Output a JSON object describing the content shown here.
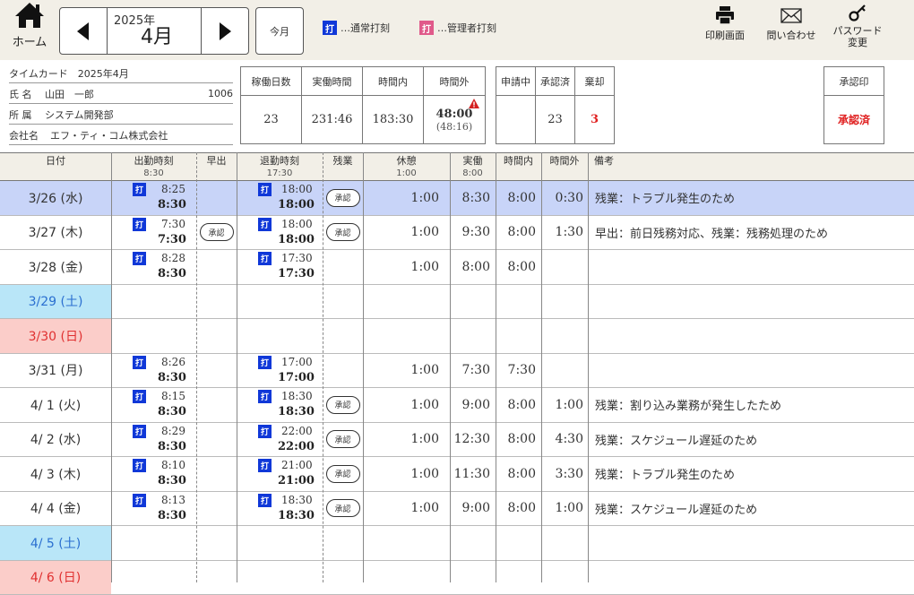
{
  "header": {
    "home_label": "ホーム",
    "year": "2025年",
    "month": "4月",
    "this_month_label": "今月",
    "legend_normal_icon": "打",
    "legend_normal": "…通常打刻",
    "legend_admin_icon": "打",
    "legend_admin": "…管理者打刻",
    "print_label": "印刷画面",
    "contact_label": "問い合わせ",
    "password_label_1": "パスワード",
    "password_label_2": "変更",
    "colors": {
      "normal_punch": "#1038d8",
      "admin_punch": "#e05a8a",
      "topbar_bg": "#f2efe7"
    }
  },
  "info": {
    "timecard_title": "タイムカード　2025年4月",
    "name_label": "氏 名",
    "name": "山田　一郎",
    "employee_no": "1006",
    "dept_label": "所 属",
    "dept": "システム開発部",
    "company_label": "会社名",
    "company": "エフ・ティ・コム株式会社"
  },
  "summary": {
    "work_days_label": "稼働日数",
    "work_days": "23",
    "actual_label": "実働時間",
    "actual": "231:46",
    "within_label": "時間内",
    "within": "183:30",
    "outside_label": "時間外",
    "outside": "48:00",
    "outside_sub": "(48:16)",
    "pending_label": "申請中",
    "pending": "",
    "approved_label": "承認済",
    "approved": "23",
    "rejected_label": "棄却",
    "rejected": "3",
    "stamp_label": "承認印",
    "stamp_value": "承認済"
  },
  "table_header": {
    "date": "日付",
    "clock_in": "出勤時刻",
    "clock_in_sub": "8:30",
    "early": "早出",
    "clock_out": "退勤時刻",
    "clock_out_sub": "17:30",
    "overtime": "残業",
    "break": "休憩",
    "break_sub": "1:00",
    "actual": "実働",
    "actual_sub": "8:00",
    "within": "時間内",
    "outside": "時間外",
    "note": "備考"
  },
  "rows": [
    {
      "date": "3/26 (水)",
      "type": "selected",
      "in_raw": "8:25",
      "in": "8:30",
      "early": "",
      "out_raw": "18:00",
      "out": "18:00",
      "ot": "承認",
      "break": "1:00",
      "actual": "8:30",
      "within": "8:00",
      "outside": "0:30",
      "note": "残業：トラブル発生のため"
    },
    {
      "date": "3/27 (木)",
      "type": "normal",
      "in_raw": "7:30",
      "in": "7:30",
      "early": "承認",
      "out_raw": "18:00",
      "out": "18:00",
      "ot": "承認",
      "break": "1:00",
      "actual": "9:30",
      "within": "8:00",
      "outside": "1:30",
      "note": "早出：前日残務対応、残業：残務処理のため"
    },
    {
      "date": "3/28 (金)",
      "type": "normal",
      "in_raw": "8:28",
      "in": "8:30",
      "early": "",
      "out_raw": "17:30",
      "out": "17:30",
      "ot": "",
      "break": "1:00",
      "actual": "8:00",
      "within": "8:00",
      "outside": "",
      "note": ""
    },
    {
      "date": "3/29 (土)",
      "type": "sat",
      "in_raw": "",
      "in": "",
      "early": "",
      "out_raw": "",
      "out": "",
      "ot": "",
      "break": "",
      "actual": "",
      "within": "",
      "outside": "",
      "note": ""
    },
    {
      "date": "3/30 (日)",
      "type": "sun",
      "in_raw": "",
      "in": "",
      "early": "",
      "out_raw": "",
      "out": "",
      "ot": "",
      "break": "",
      "actual": "",
      "within": "",
      "outside": "",
      "note": ""
    },
    {
      "date": "3/31 (月)",
      "type": "normal",
      "in_raw": "8:26",
      "in": "8:30",
      "early": "",
      "out_raw": "17:00",
      "out": "17:00",
      "ot": "",
      "break": "1:00",
      "actual": "7:30",
      "within": "7:30",
      "outside": "",
      "note": ""
    },
    {
      "date": "4/ 1 (火)",
      "type": "normal",
      "in_raw": "8:15",
      "in": "8:30",
      "early": "",
      "out_raw": "18:30",
      "out": "18:30",
      "ot": "承認",
      "break": "1:00",
      "actual": "9:00",
      "within": "8:00",
      "outside": "1:00",
      "note": "残業：割り込み業務が発生したため"
    },
    {
      "date": "4/ 2 (水)",
      "type": "normal",
      "in_raw": "8:29",
      "in": "8:30",
      "early": "",
      "out_raw": "22:00",
      "out": "22:00",
      "ot": "承認",
      "break": "1:00",
      "actual": "12:30",
      "within": "8:00",
      "outside": "4:30",
      "note": "残業：スケジュール遅延のため"
    },
    {
      "date": "4/ 3 (木)",
      "type": "normal",
      "in_raw": "8:10",
      "in": "8:30",
      "early": "",
      "out_raw": "21:00",
      "out": "21:00",
      "ot": "承認",
      "break": "1:00",
      "actual": "11:30",
      "within": "8:00",
      "outside": "3:30",
      "note": "残業：トラブル発生のため"
    },
    {
      "date": "4/ 4 (金)",
      "type": "normal",
      "in_raw": "8:13",
      "in": "8:30",
      "early": "",
      "out_raw": "18:30",
      "out": "18:30",
      "ot": "承認",
      "break": "1:00",
      "actual": "9:00",
      "within": "8:00",
      "outside": "1:00",
      "note": "残業：スケジュール遅延のため"
    },
    {
      "date": "4/ 5 (土)",
      "type": "sat",
      "in_raw": "",
      "in": "",
      "early": "",
      "out_raw": "",
      "out": "",
      "ot": "",
      "break": "",
      "actual": "",
      "within": "",
      "outside": "",
      "note": ""
    },
    {
      "date": "4/ 6 (日)",
      "type": "sun",
      "in_raw": "",
      "in": "",
      "early": "",
      "out_raw": "",
      "out": "",
      "ot": "",
      "break": "",
      "actual": "",
      "within": "",
      "outside": "",
      "note": ""
    }
  ],
  "punch_icon_char": "打"
}
